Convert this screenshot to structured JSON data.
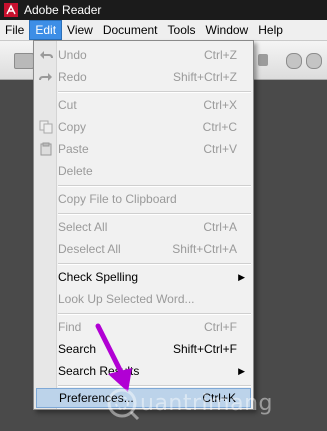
{
  "window": {
    "title": "Adobe Reader"
  },
  "menubar": {
    "items": [
      {
        "label": "File"
      },
      {
        "label": "Edit"
      },
      {
        "label": "View"
      },
      {
        "label": "Document"
      },
      {
        "label": "Tools"
      },
      {
        "label": "Window"
      },
      {
        "label": "Help"
      }
    ],
    "active": "Edit"
  },
  "edit_menu": {
    "items": [
      {
        "label": "Undo",
        "shortcut": "Ctrl+Z",
        "icon": "undo-icon"
      },
      {
        "label": "Redo",
        "shortcut": "Shift+Ctrl+Z",
        "icon": "redo-icon"
      },
      {
        "label": "Cut",
        "shortcut": "Ctrl+X"
      },
      {
        "label": "Copy",
        "shortcut": "Ctrl+C",
        "icon": "copy-icon"
      },
      {
        "label": "Paste",
        "shortcut": "Ctrl+V",
        "icon": "paste-icon"
      },
      {
        "label": "Delete",
        "shortcut": ""
      },
      {
        "label": "Copy File to Clipboard",
        "shortcut": ""
      },
      {
        "label": "Select All",
        "shortcut": "Ctrl+A"
      },
      {
        "label": "Deselect All",
        "shortcut": "Shift+Ctrl+A"
      },
      {
        "label": "Check Spelling",
        "shortcut": "",
        "submenu": true
      },
      {
        "label": "Look Up Selected Word...",
        "shortcut": ""
      },
      {
        "label": "Find",
        "shortcut": "Ctrl+F"
      },
      {
        "label": "Search",
        "shortcut": "Shift+Ctrl+F"
      },
      {
        "label": "Search Results",
        "shortcut": "",
        "submenu": true
      },
      {
        "label": "Preferences...",
        "shortcut": "Ctrl+K",
        "highlighted": true
      }
    ]
  },
  "watermark": {
    "text": "uantrimang"
  },
  "colors": {
    "menu_active": "#3d8ee6",
    "highlight": "#bcd3ea",
    "arrow": "#b100d4"
  }
}
